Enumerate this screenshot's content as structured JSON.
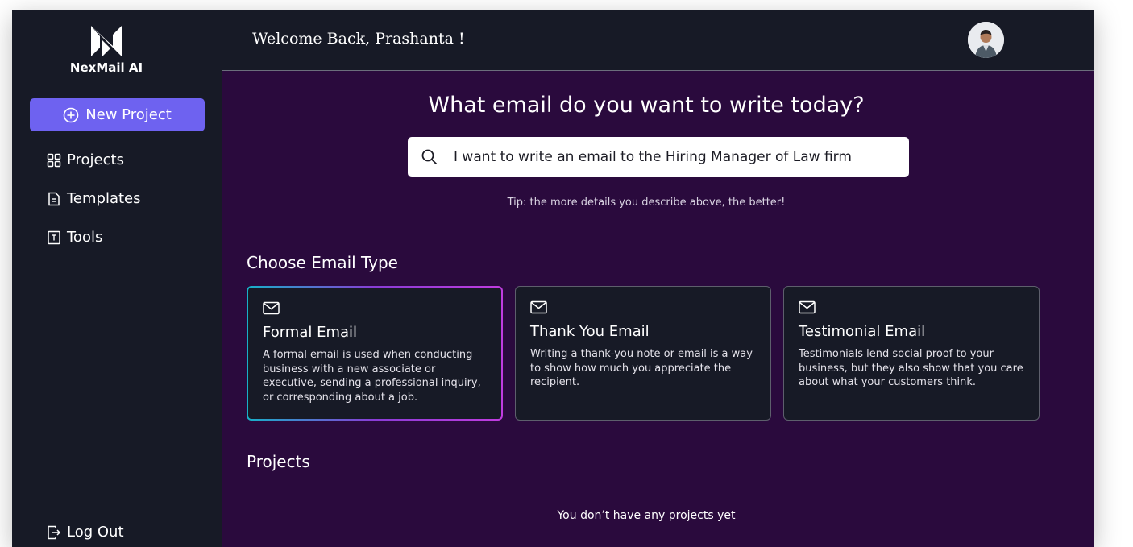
{
  "brand": {
    "name": "NexMail AI"
  },
  "sidebar": {
    "new_project_label": "New Project",
    "items": [
      {
        "label": "Projects",
        "icon": "grid-icon"
      },
      {
        "label": "Templates",
        "icon": "document-icon"
      },
      {
        "label": "Tools",
        "icon": "tools-icon"
      }
    ],
    "logout_label": "Log Out"
  },
  "header": {
    "welcome": "Welcome Back, Prashanta !"
  },
  "main": {
    "headline": "What email do you want to write today?",
    "search": {
      "value": "I want to write an email to the Hiring Manager of Law firm"
    },
    "tip": "Tip: the more details you describe above, the better!",
    "email_type_title": "Choose Email Type",
    "email_types": [
      {
        "title": "Formal Email",
        "description": "A formal email is used when conducting business with a new associate or executive, sending a professional inquiry, or corresponding about a job.",
        "selected": true
      },
      {
        "title": "Thank You Email",
        "description": "Writing a thank-you note or email is a way to show how much you appreciate the recipient.",
        "selected": false
      },
      {
        "title": "Testimonial Email",
        "description": "Testimonials lend social proof to your business, but they also show that you care about what your customers think.",
        "selected": false
      }
    ],
    "projects_title": "Projects",
    "projects_empty": "You don’t have any projects yet"
  },
  "colors": {
    "sidebar_bg": "#171a26",
    "main_bg": "#2a0a3d",
    "accent": "#6e62f0"
  }
}
